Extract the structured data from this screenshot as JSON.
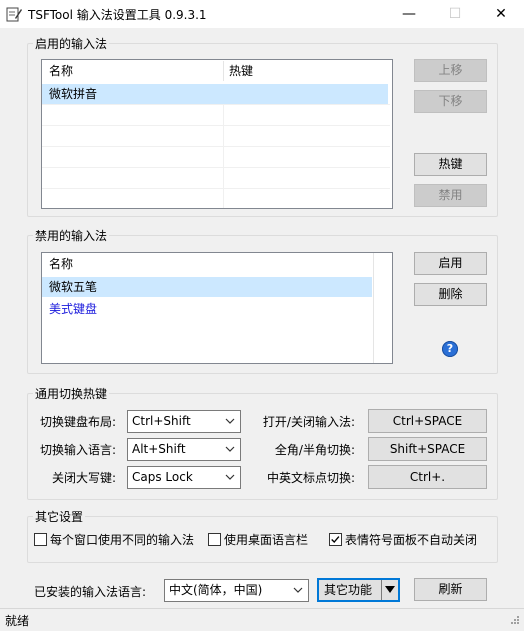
{
  "window": {
    "title": "TSFTool 输入法设置工具 0.9.3.1",
    "minimize_glyph": "—",
    "maximize_glyph": "☐",
    "close_glyph": "✕"
  },
  "enabled_group": {
    "title": "启用的输入法",
    "columns": [
      "名称",
      "热键"
    ],
    "rows": [
      {
        "name": "微软拼音",
        "hotkey": "",
        "selected": true
      }
    ],
    "buttons": {
      "up": "上移",
      "down": "下移",
      "hotkey": "热键",
      "disable": "禁用"
    }
  },
  "disabled_group": {
    "title": "禁用的输入法",
    "column": "名称",
    "rows": [
      {
        "name": "微软五笔",
        "selected": true,
        "color": "#000000"
      },
      {
        "name": "美式键盘",
        "selected": false,
        "color": "#1a1adc"
      }
    ],
    "buttons": {
      "enable": "启用",
      "delete": "删除"
    },
    "help_glyph": "?"
  },
  "hotkey_group": {
    "title": "通用切换热键",
    "left": [
      {
        "label": "切换键盘布局:",
        "value": "Ctrl+Shift"
      },
      {
        "label": "切换输入语言:",
        "value": "Alt+Shift"
      },
      {
        "label": "关闭大写键:",
        "value": "Caps Lock"
      }
    ],
    "right": [
      {
        "label": "打开/关闭输入法:",
        "value": "Ctrl+SPACE"
      },
      {
        "label": "全角/半角切换:",
        "value": "Shift+SPACE"
      },
      {
        "label": "中英文标点切换:",
        "value": "Ctrl+."
      }
    ]
  },
  "other_group": {
    "title": "其它设置",
    "checkboxes": [
      {
        "label": "每个窗口使用不同的输入法",
        "checked": false
      },
      {
        "label": "使用桌面语言栏",
        "checked": false
      },
      {
        "label": "表情符号面板不自动关闭",
        "checked": true
      }
    ]
  },
  "bottom": {
    "installed_label": "已安装的输入法语言:",
    "language_value": "中文(简体，中国)",
    "more_button": "其它功能",
    "refresh_button": "刷新"
  },
  "status": {
    "text": "就绪"
  },
  "colors": {
    "selection": "#cce8ff",
    "link_blue": "#1a1adc",
    "help_icon": "#2a6fd6"
  }
}
